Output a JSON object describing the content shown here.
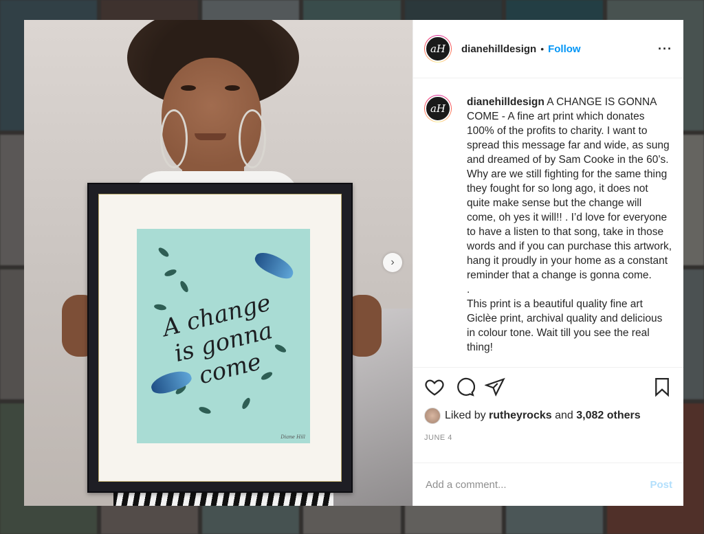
{
  "post": {
    "username": "dianehilldesign",
    "avatar_initials": "aH",
    "follow_label": "Follow",
    "separator": "•",
    "more_icon": "···",
    "next_icon": "›"
  },
  "artwork": {
    "line1": "A change",
    "line2": "is gonna",
    "line3": "come",
    "signature": "Diane Hill"
  },
  "caption": {
    "author": "dianehilldesign",
    "paragraph1": "A CHANGE IS GONNA COME - A fine art print which donates 100% of the profits to charity. I want to spread this message far and wide, as sung and dreamed of by Sam Cooke in the 60’s. Why are we still fighting for the same thing they fought for so long ago, it does not quite make sense but the change will come, oh yes it will!! . I’d love for everyone to have a listen to that song, take in those words and if you can purchase this artwork, hang it proudly in your home as a constant reminder that a change is gonna come.",
    "dot_line": ".",
    "paragraph2": "This print is a beautiful quality fine art Giclèe print, archival quality and delicious in colour tone. Wait till you see the real thing!"
  },
  "engagement": {
    "liked_by_prefix": "Liked by",
    "liked_by_user": "rutheyrocks",
    "and_word": "and",
    "others_count": "3,082 others",
    "date": "JUNE 4"
  },
  "comment": {
    "placeholder": "Add a comment...",
    "post_label": "Post"
  },
  "icons": [
    "heart-icon",
    "comment-icon",
    "share-icon",
    "save-icon",
    "chevron-right-icon",
    "more-icon"
  ],
  "colors": {
    "link_blue": "#0095f6",
    "post_disabled": "#b2dffc",
    "print_mint": "#a9dcd4"
  }
}
